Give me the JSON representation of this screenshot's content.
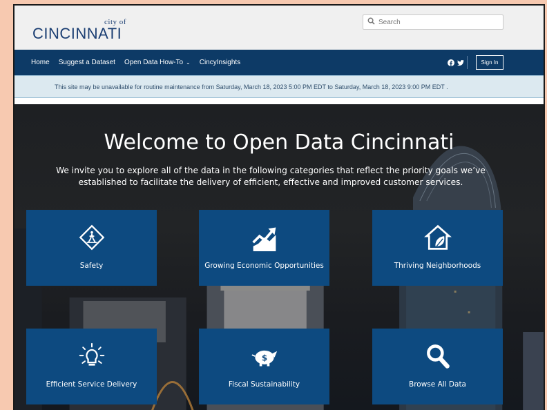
{
  "header": {
    "logo_small": "city of",
    "logo_main": "CINCINNATI",
    "search_placeholder": "Search"
  },
  "nav": {
    "items": [
      {
        "label": "Home"
      },
      {
        "label": "Suggest a Dataset"
      },
      {
        "label": "Open Data How-To"
      },
      {
        "label": "CincyInsights"
      }
    ],
    "social_icons": [
      "facebook-icon",
      "twitter-icon"
    ],
    "sign_in": "Sign In"
  },
  "banner": {
    "text": "This site may be unavailable for routine maintenance from  Saturday, March 18, 2023 5:00 PM EDT  to  Saturday, March 18, 2023 9:00 PM EDT ."
  },
  "hero": {
    "title": "Welcome to Open Data Cincinnati",
    "subtitle": "We invite you to explore all of the data in the following categories that reflect the priority goals we’ve established to facilitate the delivery of efficient, effective and improved customer services."
  },
  "tiles": [
    {
      "label": "Safety",
      "icon": "pedestrian-sign-icon"
    },
    {
      "label": "Growing Economic Opportunities",
      "icon": "trend-up-icon"
    },
    {
      "label": "Thriving Neighborhoods",
      "icon": "house-leaf-icon"
    },
    {
      "label": "Efficient Service Delivery",
      "icon": "lightbulb-icon"
    },
    {
      "label": "Fiscal Sustainability",
      "icon": "piggy-bank-icon"
    },
    {
      "label": "Browse All Data",
      "icon": "magnifier-icon"
    }
  ],
  "colors": {
    "brand_navy": "#0d3a66",
    "tile_blue": "#0d4a80",
    "banner_bg": "#dce9f0",
    "page_frame": "#f7c9b0"
  }
}
